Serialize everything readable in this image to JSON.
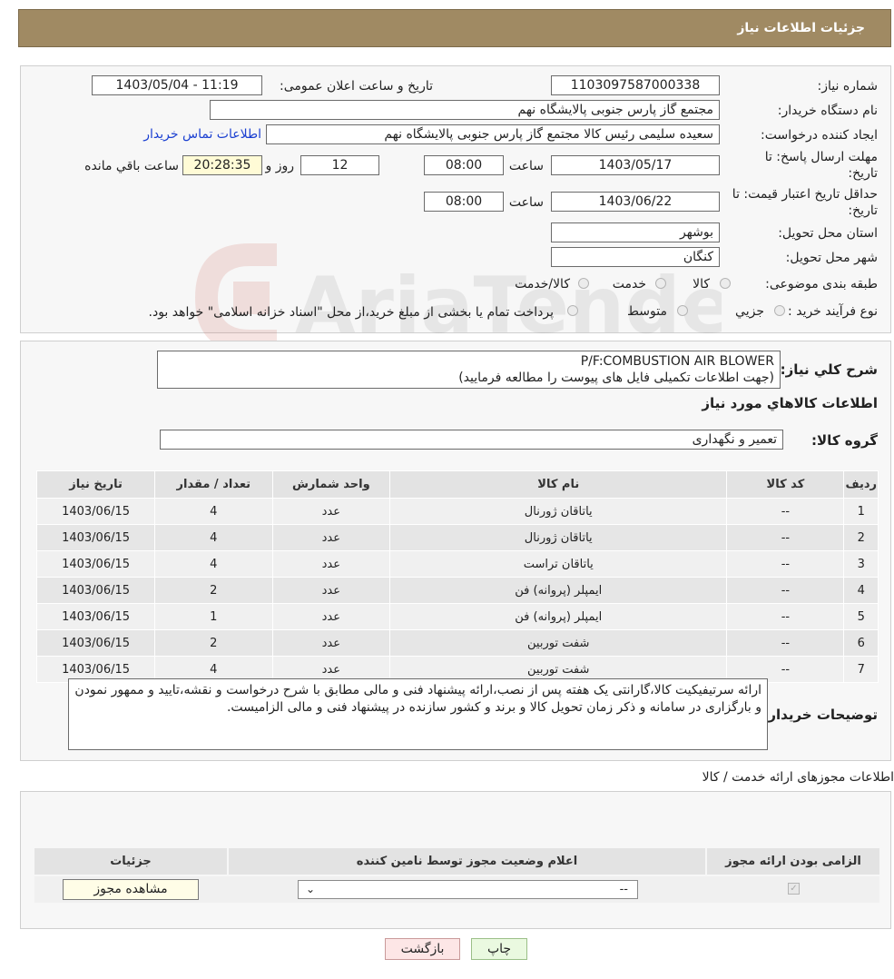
{
  "header": {
    "title": "جزئیات اطلاعات نیاز"
  },
  "form": {
    "need_number_label": "شماره نیاز:",
    "need_number": "1103097587000338",
    "announce_label": "تاریخ و ساعت اعلان عمومی:",
    "announce_value": "1403/05/04 - 11:19",
    "buyer_org_label": "نام دستگاه خریدار:",
    "buyer_org": "مجتمع گاز پارس جنوبی  پالایشگاه نهم",
    "requester_label": "ایجاد کننده درخواست:",
    "requester": "سعیده سلیمی رئیس کالا مجتمع گاز پارس جنوبی  پالایشگاه نهم",
    "contact_link": "اطلاعات تماس خریدار",
    "deadline_label_1": "مهلت ارسال پاسخ: تا",
    "deadline_label_2": "تاریخ:",
    "deadline_date": "1403/05/17",
    "time_label": "ساعت",
    "deadline_time": "08:00",
    "days_value": "12",
    "days_label": "روز و",
    "remaining_time": "20:28:35",
    "remaining_label": "ساعت باقي مانده",
    "validity_label_1": "حداقل تاریخ اعتبار قیمت: تا",
    "validity_label_2": "تاریخ:",
    "validity_date": "1403/06/22",
    "validity_time": "08:00",
    "province_label": "استان محل تحویل:",
    "province": "بوشهر",
    "city_label": "شهر محل تحویل:",
    "city": "کنگان",
    "category_label": "طبقه بندی موضوعی:",
    "category_options": [
      "کالا",
      "خدمت",
      "کالا/خدمت"
    ],
    "process_label": "نوع فرآیند خرید :",
    "process_options": [
      "جزیي",
      "متوسط"
    ],
    "process_note": "پرداخت تمام یا بخشی از مبلغ خرید،از محل \"اسناد خزانه اسلامی\" خواهد بود."
  },
  "details": {
    "summary_label": "شرح کلي نياز:",
    "summary_line1": "P/F:COMBUSTION AIR BLOWER",
    "summary_line2": "(جهت اطلاعات تکمیلی فایل های پیوست را مطالعه فرمایید)",
    "items_heading": "اطلاعات کالاهاي مورد نياز",
    "group_label": "گروه کالا:",
    "group_value": "تعمیر و نگهداری"
  },
  "items_table": {
    "headers": [
      "رديف",
      "کد کالا",
      "نام کالا",
      "واحد شمارش",
      "تعداد / مقدار",
      "تاريخ نياز"
    ],
    "rows": [
      [
        "1",
        "--",
        "یاتاقان ژورنال",
        "عدد",
        "4",
        "1403/06/15"
      ],
      [
        "2",
        "--",
        "یاتاقان ژورنال",
        "عدد",
        "4",
        "1403/06/15"
      ],
      [
        "3",
        "--",
        "یاتاقان تراست",
        "عدد",
        "4",
        "1403/06/15"
      ],
      [
        "4",
        "--",
        "ایمپلر (پروانه) فن",
        "عدد",
        "2",
        "1403/06/15"
      ],
      [
        "5",
        "--",
        "ایمپلر (پروانه) فن",
        "عدد",
        "1",
        "1403/06/15"
      ],
      [
        "6",
        "--",
        "شفت توربین",
        "عدد",
        "2",
        "1403/06/15"
      ],
      [
        "7",
        "--",
        "شفت توربین",
        "عدد",
        "4",
        "1403/06/15"
      ]
    ]
  },
  "buyer_notes": {
    "label": "توضیحات خریدار:",
    "text": "ارائه سرتیفیکیت کالا،گارانتی یک هفته پس از نصب،ارائه پیشنهاد فنی و مالی مطابق با شرح درخواست و نقشه،تایید و ممهور نمودن و بارگزاری در سامانه و ذکر زمان تحویل کالا و برند و کشور سازنده در پیشنهاد فنی و مالی الزامیست."
  },
  "permits": {
    "heading": "اطلاعات مجوزهای ارائه خدمت / کالا",
    "headers": [
      "الزامی بودن ارائه مجوز",
      "اعلام وضعیت مجوز توسط نامین کننده",
      "جزئیات"
    ],
    "select_value": "--",
    "view_button": "مشاهده مجوز"
  },
  "footer": {
    "print_button": "چاپ",
    "back_button": "بازگشت"
  },
  "watermark": {
    "text": "AriaTender.neT"
  }
}
